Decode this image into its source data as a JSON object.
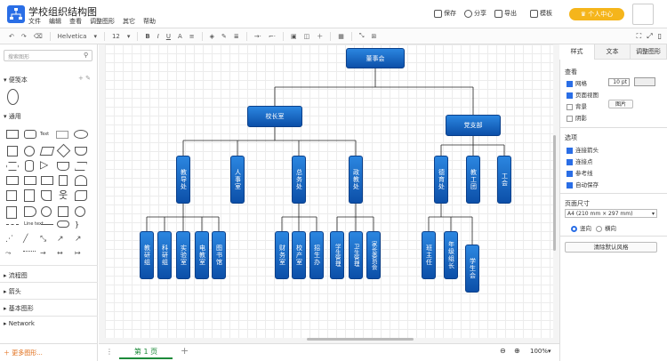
{
  "app": {
    "title": "学校组织结构图",
    "menu": [
      "文件",
      "编辑",
      "查看",
      "调整图形",
      "其它",
      "帮助"
    ],
    "actions": {
      "save": "保存",
      "share": "分享",
      "export": "导出",
      "template": "模板"
    },
    "upgrade": "个人中心"
  },
  "toolbar": {
    "font": "Helvetica",
    "font_size": "12"
  },
  "left": {
    "search_placeholder": "搜索图形",
    "scratchpad": "便笺本",
    "general": "通用",
    "sections": [
      "流程图",
      "箭头",
      "基本图形",
      "Network"
    ],
    "more": "更多图形..."
  },
  "bottom": {
    "page_tab": "第 1 页",
    "zoom": "100%"
  },
  "right": {
    "tabs": [
      "样式",
      "文本",
      "调整图形"
    ],
    "view_label": "查看",
    "grid": "网格",
    "grid_size": "10 pt",
    "page_view": "页面视图",
    "background": "背景",
    "shadow": "阴影",
    "image_btn": "图片",
    "options_label": "选项",
    "connection_arrows": "连接箭头",
    "connection_points": "连接点",
    "guides": "参考线",
    "autosave": "自动保存",
    "page_size_label": "页面尺寸",
    "page_size": "A4 (210 mm × 297 mm)",
    "portrait": "竖向",
    "landscape": "横向",
    "reset_style": "清除默认风格"
  },
  "diagram": {
    "root": "董事会",
    "l1": [
      "校长室",
      "党支部"
    ],
    "principal_children": [
      "教导处",
      "人事室",
      "总务处",
      "政教处"
    ],
    "party_children": [
      "德育处",
      "教工团",
      "工会"
    ],
    "jiaodao": [
      "教研组",
      "科研组",
      "实验室",
      "电教室",
      "图书馆"
    ],
    "zongwu": [
      "财务室",
      "校产室",
      "招生办"
    ],
    "zhengjiao": [
      "学生管理",
      "卫生管理",
      "家长委员会"
    ],
    "deyu": [
      "班主任",
      "年级组长",
      "学生会"
    ]
  },
  "colors": {
    "accent": "#2a6ee6",
    "node_top": "#2b86e0",
    "node_bottom": "#0c4fa8",
    "upgrade": "#f5b51b",
    "page_tab": "#1d8a3a"
  }
}
